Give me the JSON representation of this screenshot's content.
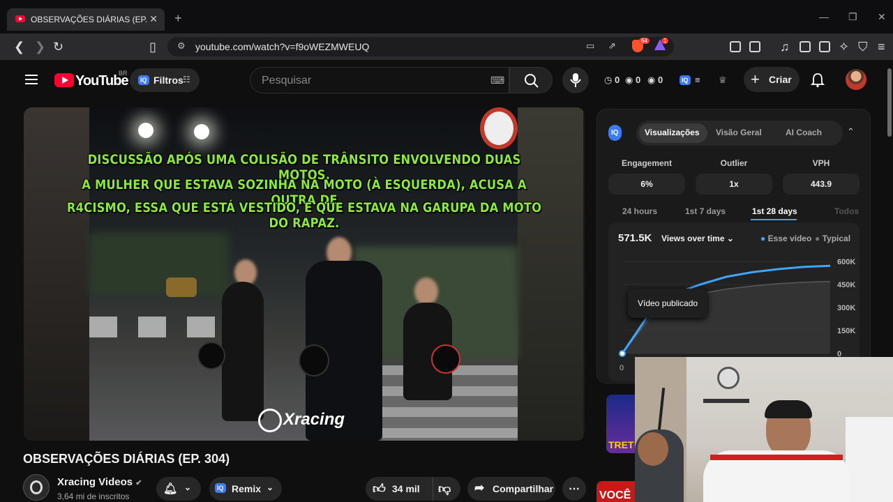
{
  "browser": {
    "tab_title": "OBSERVAÇÕES DIÁRIAS (EP. 304)",
    "url": "youtube.com/watch?v=f9oWEZMWEUQ",
    "brave_badge": "64",
    "alert_badge": "1"
  },
  "youtube": {
    "logo_text": "YouTube",
    "country": "BR",
    "filters_label": "Filtros",
    "search_placeholder": "Pesquisar",
    "counters": [
      "0",
      "0",
      "0"
    ],
    "create_label": "Criar"
  },
  "video": {
    "caption_lines": [
      "DISCUSSÃO APÓS UMA COLISÃO DE TRÂNSITO ENVOLVENDO DUAS MOTOS.",
      "A MULHER QUE ESTAVA SOZINHA NA MOTO (À ESQUERDA), ACUSA A OUTRA DE",
      "R4CISMO, ESSA QUE ESTÁ VESTIDO, E QUE ESTAVA NA GARUPA DA MOTO DO RAPAZ."
    ],
    "watermark": "Xracing",
    "title": "OBSERVAÇÕES DIÁRIAS (EP. 304)",
    "channel": "Xracing Videos",
    "subscribers": "3,64 mi de inscritos",
    "remix_label": "Remix",
    "likes": "34 mil",
    "share_label": "Compartilhar"
  },
  "panel": {
    "tabs": [
      "Visualizações",
      "Visão Geral",
      "AI Coach"
    ],
    "active_tab": "Visualizações",
    "metrics": [
      {
        "label": "Engagement",
        "value": "6%"
      },
      {
        "label": "Outlier",
        "value": "1x"
      },
      {
        "label": "VPH",
        "value": "443.9"
      }
    ],
    "ranges": [
      "24 hours",
      "1st 7 days",
      "1st 28 days",
      "Todos"
    ],
    "active_range": "1st 28 days",
    "views_total": "571.5K",
    "views_dropdown": "Views over time",
    "legend": [
      "Esse vídeo",
      "Typical"
    ],
    "tooltip": "Vídeo publicado",
    "accent": "#3ea6ff"
  },
  "chart_data": {
    "type": "line",
    "x_tick_labels": [
      "0"
    ],
    "y_tick_labels": [
      "600K",
      "450K",
      "300K",
      "150K",
      "0"
    ],
    "ylim": [
      0,
      600000
    ],
    "series": [
      {
        "name": "Esse vídeo",
        "values": [
          0,
          250000,
          390000,
          450000,
          500000,
          530000,
          550000,
          565000,
          571500
        ]
      },
      {
        "name": "Typical",
        "values": [
          0,
          220000,
          330000,
          390000,
          420000,
          440000,
          455000,
          465000,
          470000
        ]
      }
    ],
    "grid": true,
    "legend_position": "top-right"
  },
  "sidebar_thumbs": [
    "TRET",
    "VOCÊ"
  ]
}
